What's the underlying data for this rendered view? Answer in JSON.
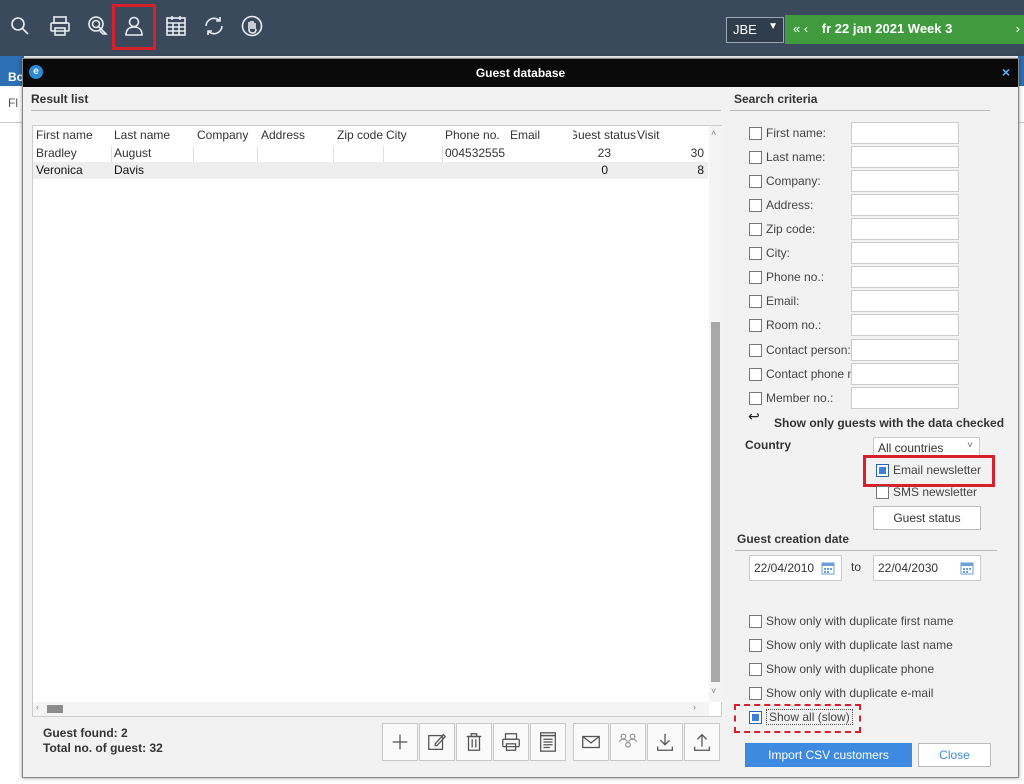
{
  "toolbar": {
    "icons": [
      "search-icon",
      "print-icon",
      "touch-icon",
      "guest-icon",
      "calendar-icon",
      "refresh-icon",
      "stop-hand-icon"
    ],
    "user_code": "JBE",
    "date_nav_back": "« ‹",
    "date_label": "fr 22 jan 2021 Week 3",
    "date_nav_forward": "›",
    "accent": "#3f9b3d",
    "highlight_color": "#d6202c"
  },
  "background_page": {
    "tab_fragment": "Bo",
    "row_fragment": "Fl"
  },
  "dialog": {
    "title": "Guest database",
    "close": "×",
    "logo": "e"
  },
  "result_list": {
    "label": "Result list",
    "columns": [
      "First name",
      "Last name",
      "Company",
      "Address",
      "Zip code",
      "City",
      "Phone no.",
      "Email",
      "Guest status",
      "Visit"
    ],
    "rows": [
      {
        "first": "Bradley",
        "last": "August",
        "company": "",
        "address": "",
        "zip": "",
        "city": "",
        "phone": "004532555",
        "email": "",
        "status": "23",
        "visit": "30"
      },
      {
        "first": "Veronica",
        "last": "Davis",
        "company": "",
        "address": "",
        "zip": "",
        "city": "",
        "phone": "",
        "email": "",
        "status": "0",
        "visit": "8"
      }
    ],
    "guests_found_label": "Guest found:",
    "guests_found_value": "2",
    "total_label": "Total no. of guest:",
    "total_value": "32"
  },
  "actions": {
    "icons": [
      "add-icon",
      "edit-icon",
      "delete-icon",
      "print-icon",
      "report-icon",
      "email-icon",
      "merge-guests-icon",
      "download-icon",
      "upload-icon"
    ]
  },
  "search_criteria": {
    "label": "Search criteria",
    "fields": [
      {
        "label": "First name:",
        "checked": false
      },
      {
        "label": "Last name:",
        "checked": false
      },
      {
        "label": "Company:",
        "checked": false
      },
      {
        "label": "Address:",
        "checked": false
      },
      {
        "label": "Zip code:",
        "checked": false
      },
      {
        "label": "City:",
        "checked": false
      },
      {
        "label": "Phone no.:",
        "checked": false
      },
      {
        "label": "Email:",
        "checked": false
      },
      {
        "label": "Room no.:",
        "checked": false
      },
      {
        "label": "Contact person:",
        "checked": false
      },
      {
        "label": "Contact phone no.:",
        "checked": false
      },
      {
        "label": "Member no.:",
        "checked": false
      }
    ],
    "only_checked_hint": "Show only guests with the data checked",
    "country_label": "Country",
    "country_value": "All countries",
    "email_newsletter_label": "Email newsletter",
    "email_newsletter_checked": true,
    "sms_newsletter_label": "SMS newsletter",
    "sms_newsletter_checked": false,
    "guest_status_button": "Guest status"
  },
  "creation_date": {
    "label": "Guest creation date",
    "from": "22/04/2010",
    "to_label": "to",
    "to": "22/04/2030"
  },
  "filters": [
    {
      "label": "Show only with duplicate first name",
      "checked": false
    },
    {
      "label": "Show only with duplicate last name",
      "checked": false
    },
    {
      "label": "Show only with duplicate phone",
      "checked": false
    },
    {
      "label": "Show only with duplicate e-mail",
      "checked": false
    },
    {
      "label": "Show all (slow)",
      "checked": true
    }
  ],
  "footer": {
    "import_button": "Import CSV customers",
    "close_button": "Close"
  }
}
